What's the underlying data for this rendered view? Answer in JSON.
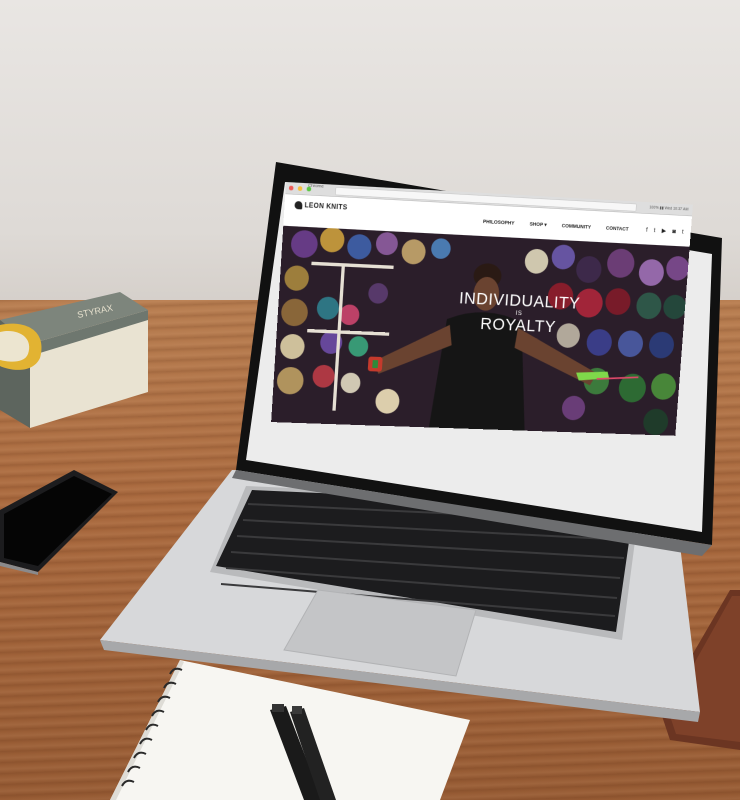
{
  "browser": {
    "window_title": "Chrome",
    "status": "100% ▮▮ Wed 10:37 AM"
  },
  "site": {
    "logo_text": "LEON KNITS",
    "nav": [
      "PHILOSOPHY",
      "SHOP ▾",
      "COMMUNITY",
      "CONTACT"
    ],
    "social_icons": [
      "facebook-icon",
      "twitter-icon",
      "youtube-icon",
      "instagram-icon",
      "tumblr-icon"
    ],
    "social_glyphs": [
      "f",
      "t",
      "▶",
      "◙",
      "t"
    ],
    "hero": {
      "line1": "INDIVIDUALITY",
      "line2": "IS",
      "line3": "ROYALTY"
    }
  },
  "book": {
    "spine_text": "STYRAX"
  },
  "colors": {
    "wall": "#e2dedb",
    "desk": "#a9693e",
    "laptop_body": "#c9cacc",
    "bezel": "#111111",
    "hero_bg": "#2b1e2a"
  }
}
